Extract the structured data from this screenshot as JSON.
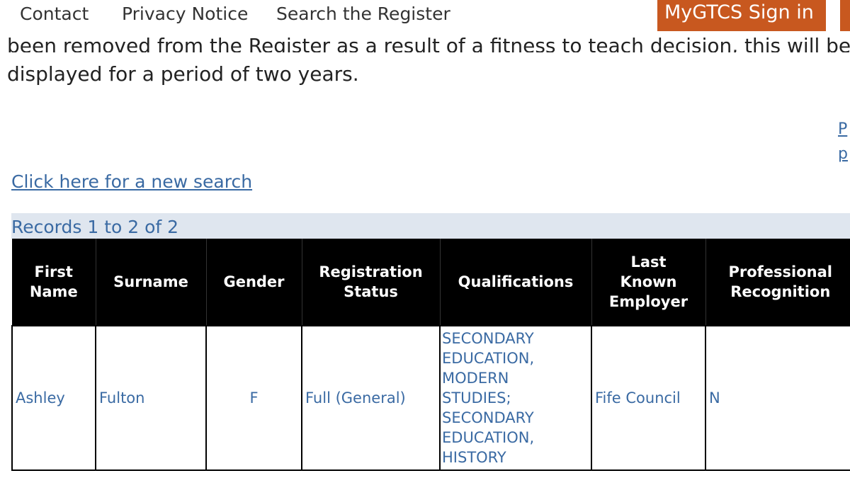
{
  "nav": {
    "contact": "Contact",
    "privacy": "Privacy Notice",
    "search_register": "Search the Register",
    "signin": "MyGTCS Sign in"
  },
  "intro": {
    "cut_line": "been removed from the Register as a result of a fitness to teach decision, this will be",
    "line": "displayed for a period of two years."
  },
  "side_links": [
    "P",
    "p"
  ],
  "new_search_link": "Click here for a new search",
  "records_label": "Records 1 to 2 of 2",
  "table": {
    "headers": [
      "First\nName",
      "Surname",
      "Gender",
      "Registration\nStatus",
      "Qualifications",
      "Last\nKnown\nEmployer",
      "Professional\nRecognition"
    ],
    "rows": [
      {
        "first_name": "Ashley",
        "surname": "Fulton",
        "gender": "F",
        "registration_status": "Full (General)",
        "qualifications": "SECONDARY\nEDUCATION,\nMODERN\nSTUDIES;\nSECONDARY\nEDUCATION,\nHISTORY",
        "last_known_employer": "Fife Council",
        "professional_recognition": "N"
      }
    ]
  },
  "colors": {
    "signin_bg": "#c8581f",
    "link": "#3a6aa3",
    "records_bar_bg": "#dfe6ef",
    "table_header_bg": "#000000"
  }
}
